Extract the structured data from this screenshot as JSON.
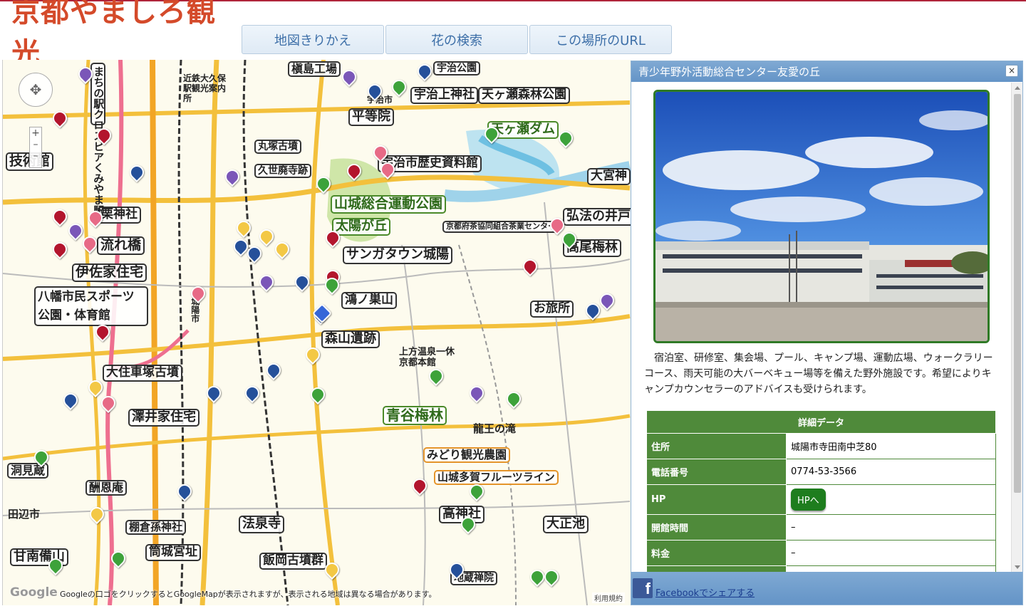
{
  "header": {
    "logo_text": "京都やましろ観光",
    "nav": [
      "地図きりかえ",
      "花の検索",
      "この場所のURL"
    ]
  },
  "map": {
    "labels": [
      "槇島工場",
      "宇治公園",
      "宇治上神社",
      "天ヶ瀬森林公園",
      "平等院",
      "天ヶ瀬ダム",
      "宇治市歴史資料館",
      "大宮神",
      "久世廃寺跡",
      "丸塚古墳",
      "栗神社",
      "山城総合運動公園",
      "太陽が丘",
      "京都府茶協同組合茶業センター",
      "サンガタウン城陽",
      "弘法の井戸",
      "高尾梅林",
      "鴻ノ巣山",
      "お旅所",
      "流れ橋",
      "伊佐家住宅",
      "八幡市民スポーツ公園・体育館",
      "森山遺跡",
      "上方温泉一休京都本館",
      "大住車塚古墳",
      "澤井家住宅",
      "青谷梅林",
      "龍王の滝",
      "みどり観光農園",
      "山城多賀フルーツライン",
      "高神社",
      "甘南備山",
      "田辺市",
      "洞見蔵",
      "大正池",
      "城陽市",
      "宇治市",
      "技術館",
      "まちの駅クロスピアくみやま駅",
      "近鉄大久保駅観光案内所",
      "法泉寺",
      "飯岡古墳群",
      "地蔵禅院",
      "棚倉孫神社",
      "筒城宮址",
      "酬恩庵"
    ],
    "google_label": "Google",
    "note": "Googleの口ゴをクリックするとGoogleMapが表示されますが、表示される地域は異なる場合があります。",
    "terms": "利用規約"
  },
  "panel": {
    "title": "青少年野外活動総合センター友愛の丘",
    "close": "×",
    "description": "宿泊室、研修室、集会場、プール、キャンプ場、運動広場、ウォークラリーコース、雨天可能の大バーベキュー場等を備えた野外施設です。希望によりキャンプカウンセラーのアドバイスも受けられます。",
    "table_heading": "詳細データ",
    "rows": [
      {
        "key": "住所",
        "value": "城陽市寺田南中芝80"
      },
      {
        "key": "電話番号",
        "value": "0774-53-3566"
      },
      {
        "key": "HP",
        "value": "HPへ"
      },
      {
        "key": "開館時間",
        "value": "–"
      },
      {
        "key": "料金",
        "value": "–"
      }
    ],
    "share": "Facebookでシェアする",
    "fb_letter": "f"
  },
  "colors": {
    "accent_green": "#4f8a3a",
    "panel_blue": "#6494c7",
    "nav_text": "#3d6fa8"
  }
}
